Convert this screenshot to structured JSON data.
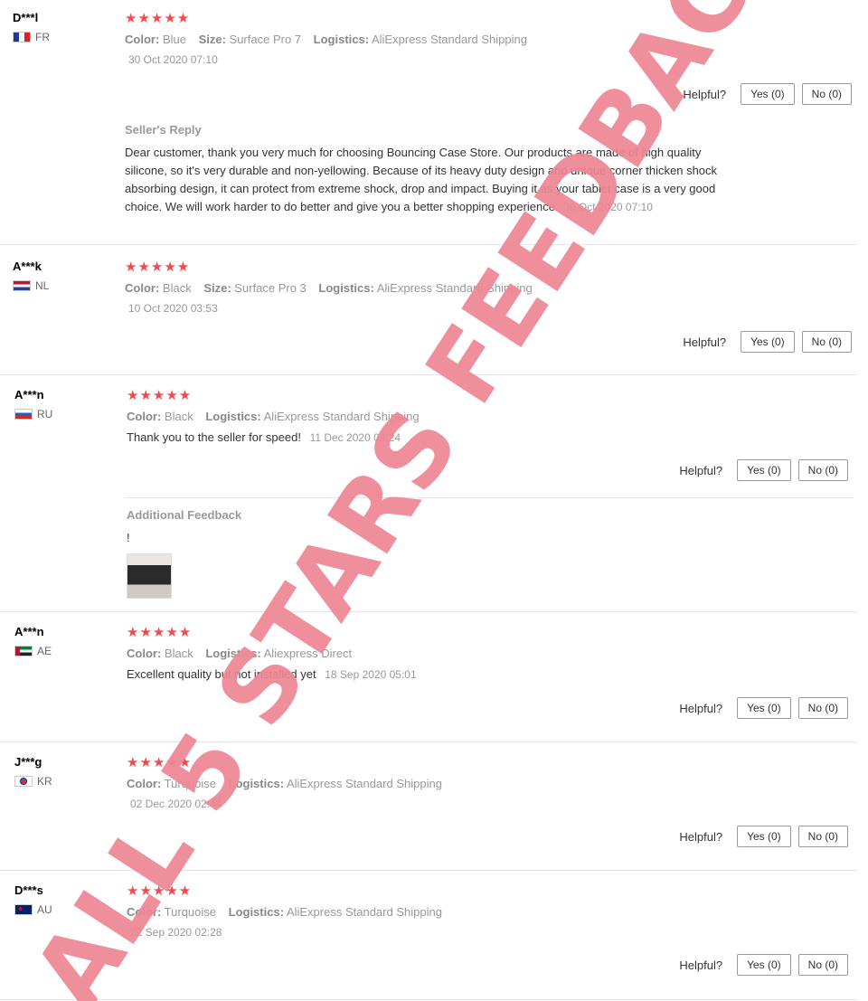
{
  "reviews": [
    {
      "user": "D***l",
      "country_code": "FR",
      "stars": "★★★★★",
      "color_label": "Color:",
      "color": "Blue",
      "size_label": "Size:",
      "size": "Surface Pro 7",
      "logistics_label": "Logistics:",
      "logistics": "AliExpress Standard Shipping",
      "date": "30 Oct 2020 07:10",
      "helpful_label": "Helpful?",
      "yes": "Yes (0)",
      "no": "No (0)",
      "reply_title": "Seller's Reply",
      "reply_text": "Dear customer, thank you very much for choosing Bouncing Case Store. Our products are made of high quality silicone, so it's very durable and non-yellowing. Because of its heavy duty design and unique corner thicken shock absorbing design, it can protect from extreme shock, drop and impact. Buying it as your tablet case is a very good choice. We will work harder to do better and give you a better shopping experience.",
      "reply_date": "30 Oct 2020 07:10"
    },
    {
      "user": "A***k",
      "country_code": "NL",
      "stars": "★★★★★",
      "color_label": "Color:",
      "color": "Black",
      "size_label": "Size:",
      "size": "Surface Pro 3",
      "logistics_label": "Logistics:",
      "logistics": "AliExpress Standard Shipping",
      "date": "10 Oct 2020 03:53",
      "helpful_label": "Helpful?",
      "yes": "Yes (0)",
      "no": "No (0)"
    },
    {
      "user": "A***n",
      "country_code": "RU",
      "stars": "★★★★★",
      "color_label": "Color:",
      "color": "Black",
      "logistics_label": "Logistics:",
      "logistics": "AliExpress Standard Shipping",
      "text": "Thank you to the seller for speed!",
      "date": "11 Dec 2020 08:24",
      "helpful_label": "Helpful?",
      "yes": "Yes (0)",
      "no": "No (0)",
      "additional_title": "Additional Feedback",
      "additional_text": "!"
    },
    {
      "user": "A***n",
      "country_code": "AE",
      "stars": "★★★★★",
      "color_label": "Color:",
      "color": "Black",
      "logistics_label": "Logistics:",
      "logistics": "Aliexpress Direct",
      "text": "Excellent quality but not installed yet",
      "date": "18 Sep 2020 05:01",
      "helpful_label": "Helpful?",
      "yes": "Yes (0)",
      "no": "No (0)"
    },
    {
      "user": "J***g",
      "country_code": "KR",
      "stars": "★★★★★",
      "color_label": "Color:",
      "color": "Turquoise",
      "logistics_label": "Logistics:",
      "logistics": "AliExpress Standard Shipping",
      "date": "02 Dec 2020 02:44",
      "helpful_label": "Helpful?",
      "yes": "Yes (0)",
      "no": "No (0)"
    },
    {
      "user": "D***s",
      "country_code": "AU",
      "stars": "★★★★★",
      "color_label": "Color:",
      "color": "Turquoise",
      "logistics_label": "Logistics:",
      "logistics": "AliExpress Standard Shipping",
      "date": "22 Sep 2020 02:28",
      "helpful_label": "Helpful?",
      "yes": "Yes (0)",
      "no": "No (0)"
    }
  ],
  "watermark": {
    "text": "ALL 5 STARS FEEDBACK",
    "color": "#ee8594"
  },
  "colors": {
    "star": "#f44a4a",
    "muted": "#999999",
    "divider": "#e6e6e6"
  }
}
